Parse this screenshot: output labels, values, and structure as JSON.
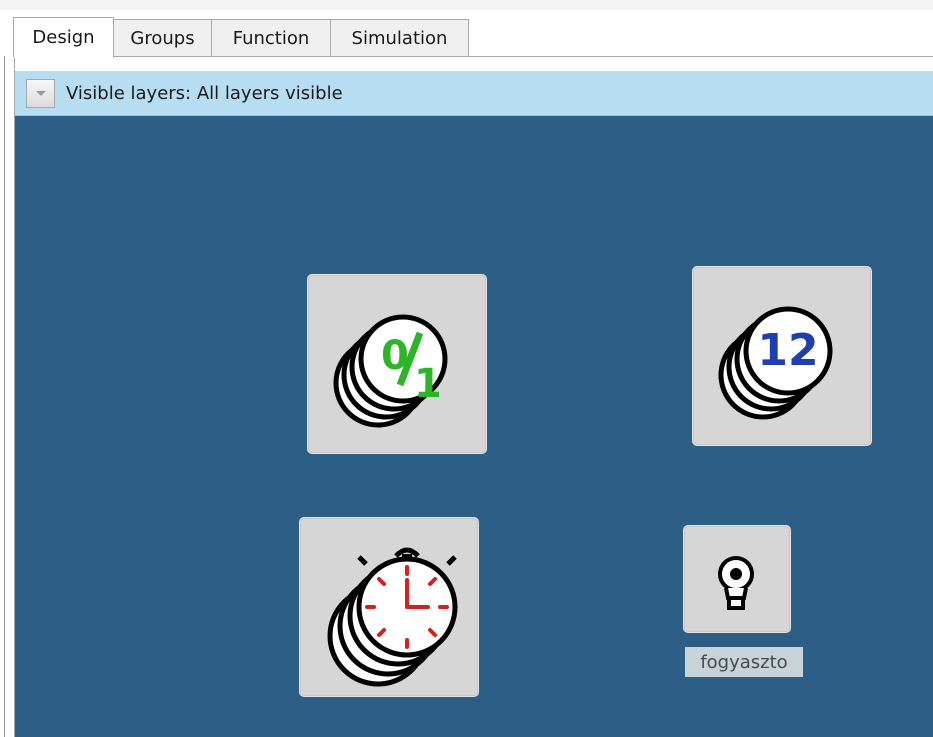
{
  "tabs": [
    {
      "label": "Design",
      "active": true
    },
    {
      "label": "Groups",
      "active": false
    },
    {
      "label": "Function",
      "active": false
    },
    {
      "label": "Simulation",
      "active": false
    }
  ],
  "layers": {
    "text": "Visible layers: All layers visible"
  },
  "canvas": {
    "background": "#2c5e86",
    "blocks": [
      {
        "icon": "binary-counter-icon",
        "text": "0/1",
        "accent": "#2db52a"
      },
      {
        "icon": "numeric-counter-icon",
        "text": "12",
        "accent": "#1f3fb0"
      },
      {
        "icon": "timer-stopwatch-icon",
        "accent": "#d42020"
      },
      {
        "icon": "consumer-lamp-icon",
        "label": "fogyaszto"
      }
    ]
  },
  "colors": {
    "layer_bar": "#b7ddf2",
    "block_bg": "#d6d6d6"
  }
}
